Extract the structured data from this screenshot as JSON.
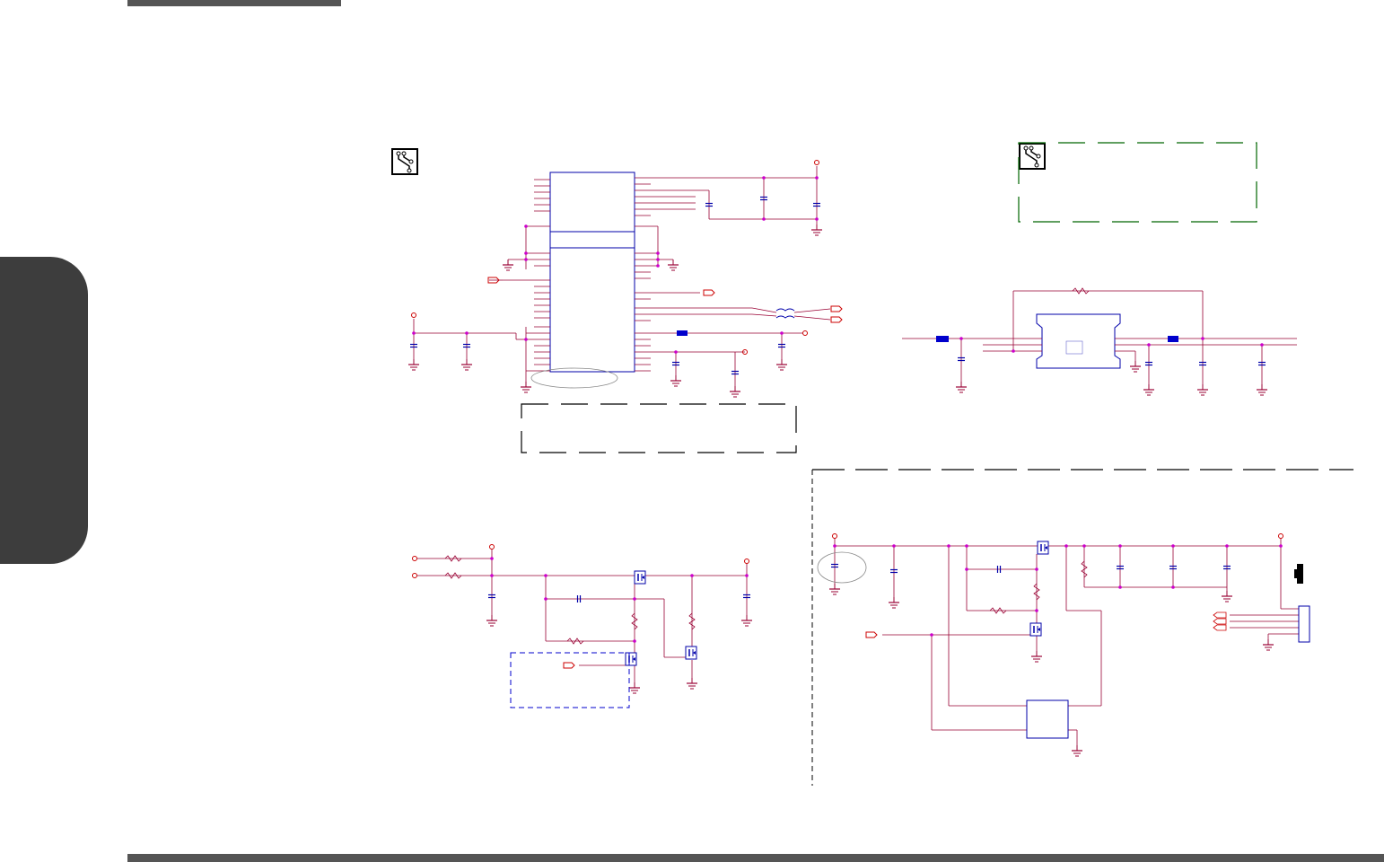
{
  "page": {
    "colors": {
      "wire": "#990033",
      "symbol": "#0000aa",
      "junction": "#cc00cc",
      "note_box": "#000000",
      "note_box_green": "#006600",
      "side_tab": "#3d3d3d",
      "page_bars": "#555555"
    }
  },
  "icons": {
    "note_icon_left": "schematic-note-icon",
    "note_icon_right": "schematic-note-icon"
  }
}
